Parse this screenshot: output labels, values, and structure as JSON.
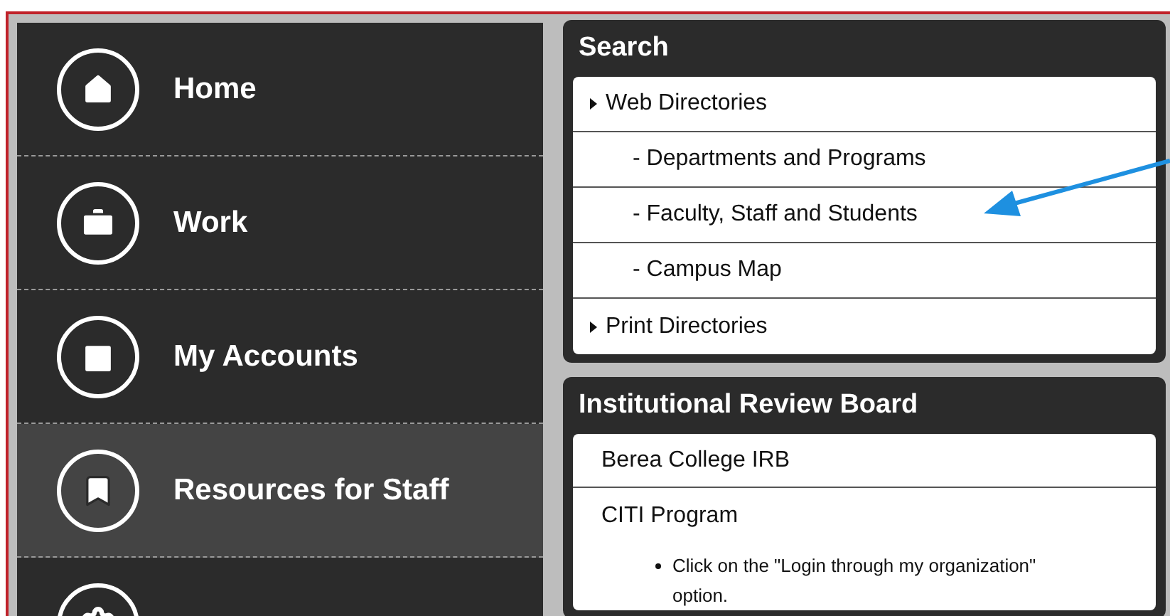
{
  "nav": {
    "items": [
      {
        "label": "Home",
        "kind": "home",
        "selected": false
      },
      {
        "label": "Work",
        "kind": "work",
        "selected": false
      },
      {
        "label": "My Accounts",
        "kind": "accounts",
        "selected": false
      },
      {
        "label": "Resources for Staff",
        "kind": "resources",
        "selected": true
      },
      {
        "kind": "settings",
        "selected": false
      }
    ]
  },
  "panels": [
    {
      "title": "Search",
      "rows": [
        {
          "kind": "heading",
          "text": "Web Directories"
        },
        {
          "kind": "sub",
          "text": "- Departments and Programs"
        },
        {
          "kind": "sub",
          "text": "- Faculty, Staff and Students"
        },
        {
          "kind": "sub",
          "text": "- Campus Map"
        },
        {
          "kind": "heading",
          "text": "Print Directories"
        }
      ]
    },
    {
      "title": "Institutional Review Board",
      "rows": [
        {
          "kind": "link",
          "text": "Berea College IRB"
        },
        {
          "kind": "section",
          "text": "CITI Program",
          "bullets": [
            "Click on the \"Login through my organization\" option."
          ]
        }
      ]
    }
  ]
}
